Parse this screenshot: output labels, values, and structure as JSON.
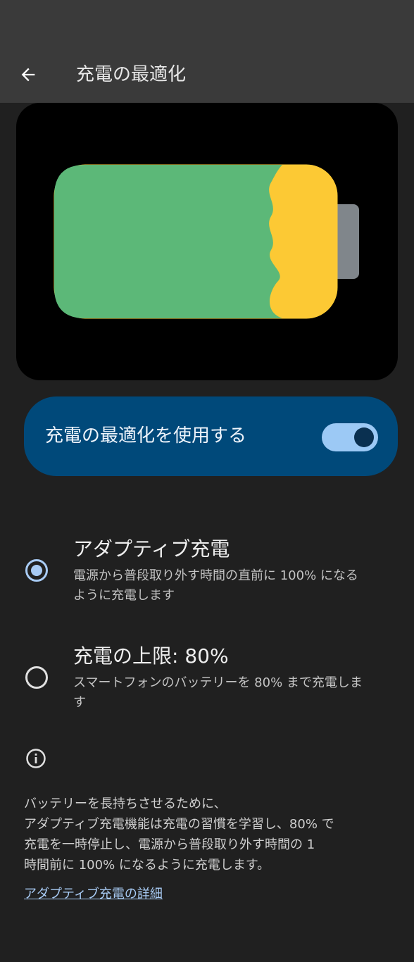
{
  "app_bar": {
    "title": "充電の最適化",
    "back_icon": "arrow-back-icon"
  },
  "colors": {
    "battery_green": "#5cb878",
    "battery_yellow": "#fcc934",
    "battery_terminal": "#80868b",
    "toggle_card": "#00497a",
    "accent": "#a8cbf4"
  },
  "toggle": {
    "label": "充電の最適化を使用する",
    "on": true
  },
  "options": [
    {
      "title": "アダプティブ充電",
      "description": "電源から普段取り外す時間の直前に 100% になるように充電します",
      "selected": true
    },
    {
      "title": "充電の上限: 80%",
      "description": "スマートフォンのバッテリーを 80% まで充電します",
      "selected": false
    }
  ],
  "info": {
    "icon": "info-icon",
    "text": "バッテリーを長持ちさせるために、\nアダプティブ充電機能は充電の習慣を学習し、80% で\n充電を一時停止し、電源から普段取り外す時間の 1\n時間前に 100% になるように充電します。",
    "link": "アダプティブ充電の詳細"
  }
}
